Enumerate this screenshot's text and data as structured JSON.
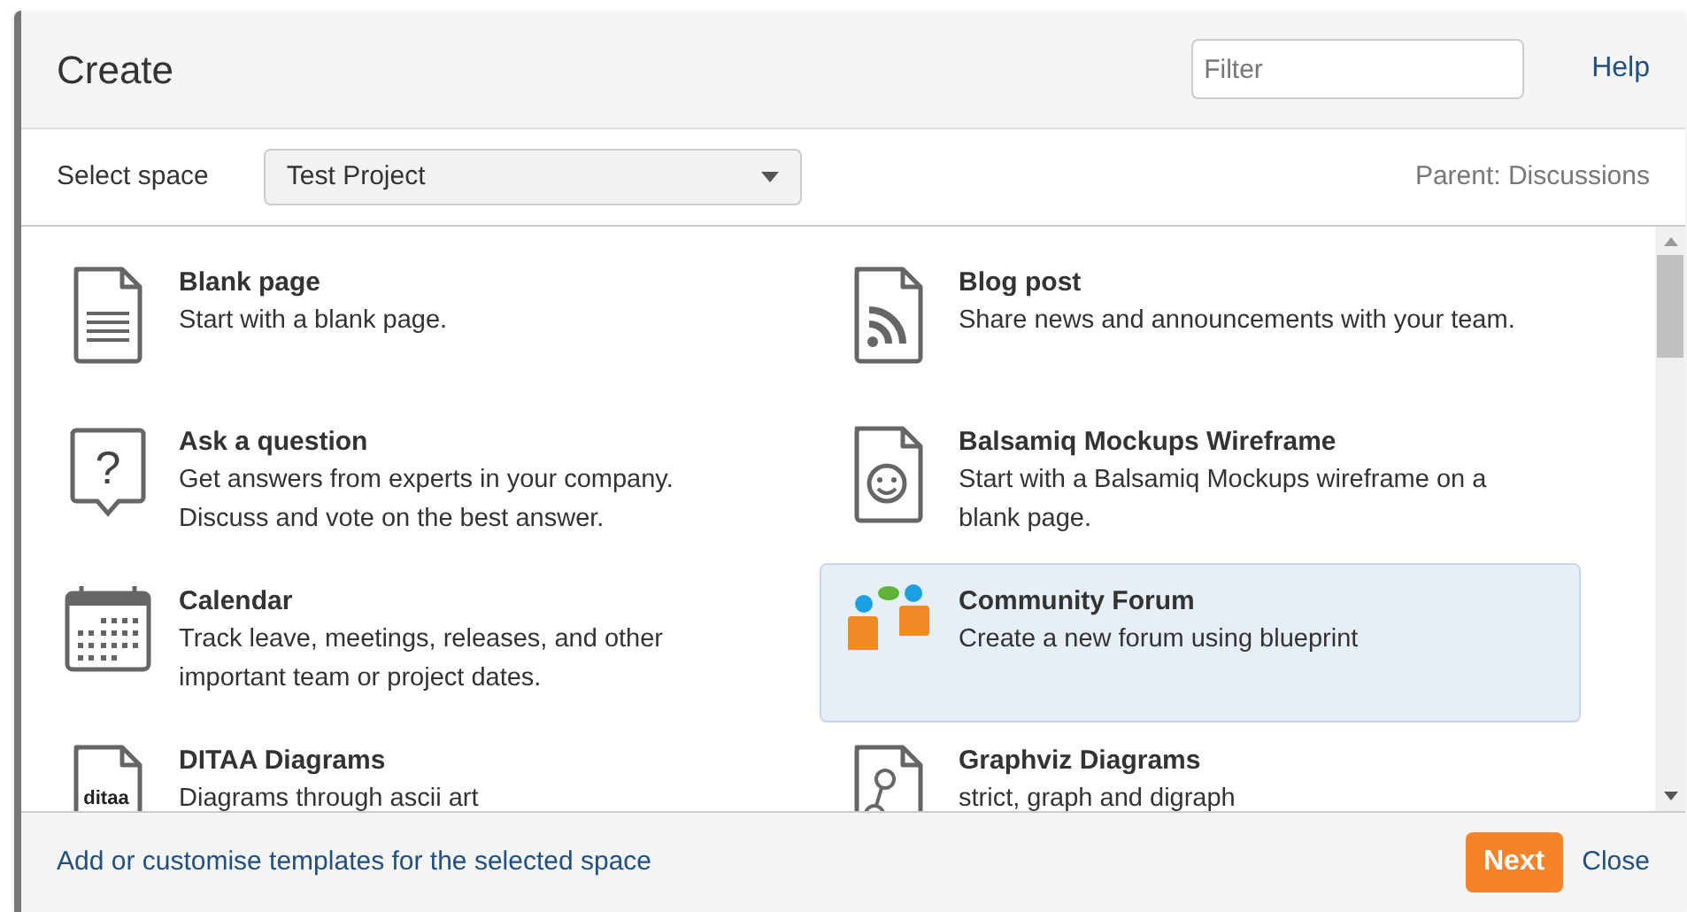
{
  "dialog": {
    "title": "Create",
    "filter": {
      "placeholder": "Filter"
    },
    "help": "Help"
  },
  "space": {
    "label": "Select space",
    "value": "Test Project",
    "parent": "Parent: Discussions"
  },
  "templates": [
    {
      "title": "Blank page",
      "description": "Start with a blank page.",
      "selected": false
    },
    {
      "title": "Blog post",
      "description": "Share news and announcements with your team.",
      "selected": false
    },
    {
      "title": "Ask a question",
      "icon_label": "?",
      "description": "Get answers from experts in your company. Discuss and vote on the best answer.",
      "selected": false
    },
    {
      "title": "Balsamiq Mockups Wireframe",
      "description": "Start with a Balsamiq Mockups wireframe on a blank page.",
      "selected": false
    },
    {
      "title": "Calendar",
      "description": "Track leave, meetings, releases, and other important team or project dates.",
      "selected": false
    },
    {
      "title": "Community Forum",
      "description": "Create a new forum using blueprint",
      "selected": true
    },
    {
      "title": "DITAA Diagrams",
      "icon_label": "ditaa",
      "description": "Diagrams through ascii art",
      "selected": false
    },
    {
      "title": "Graphviz Diagrams",
      "description": "strict, graph and digraph",
      "selected": false
    }
  ],
  "footer": {
    "link": "Add or customise templates for the selected space",
    "next": "Next",
    "close": "Close"
  }
}
